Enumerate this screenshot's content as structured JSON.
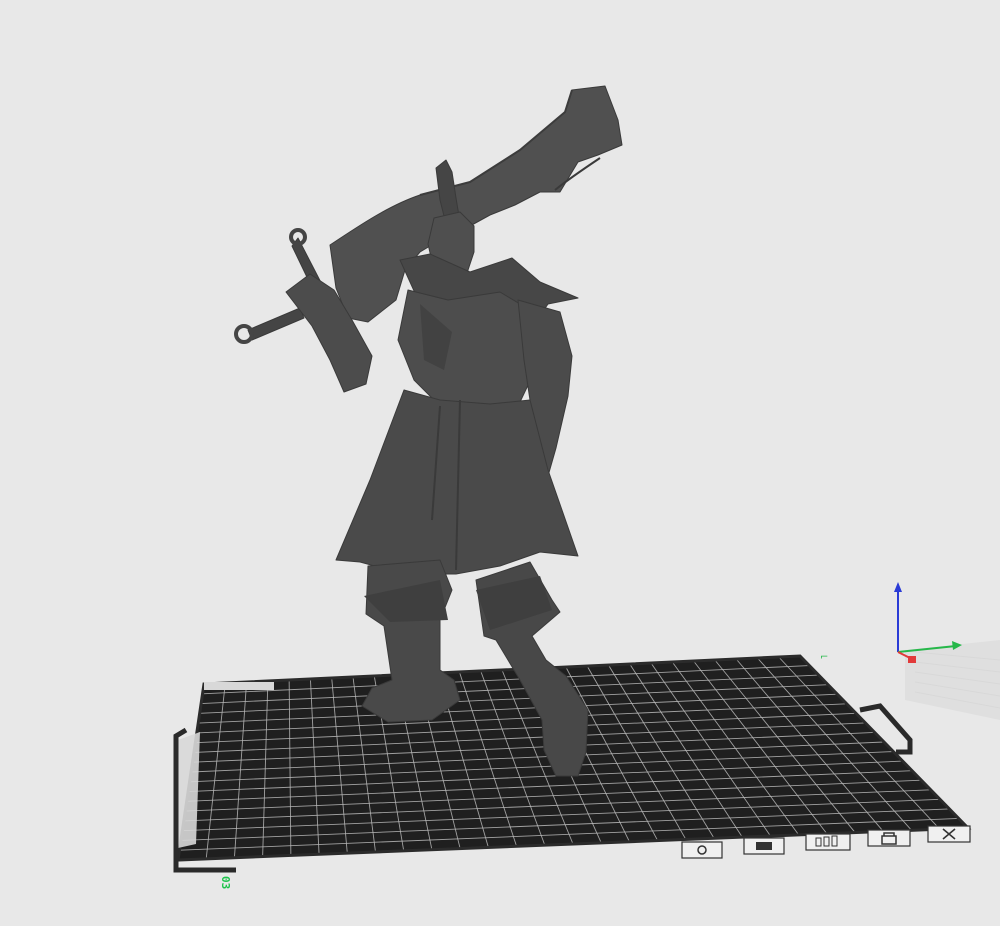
{
  "viewport": {
    "background_color": "#e8e8e8",
    "plate_color": "#262626",
    "grid_line_color": "#bfbfbf",
    "model_color": "#4a4a4a",
    "model_shadow_color": "#383838",
    "plate_number": "03",
    "plate_number_color": "#1cc24a",
    "axis_colors": {
      "x": "#e23a3a",
      "y": "#26b84a",
      "z": "#2a3bd6"
    },
    "plate_toolbar_icons": [
      "orient-icon",
      "arrange-icon",
      "layers-icon",
      "lock-icon",
      "close-icon"
    ]
  }
}
